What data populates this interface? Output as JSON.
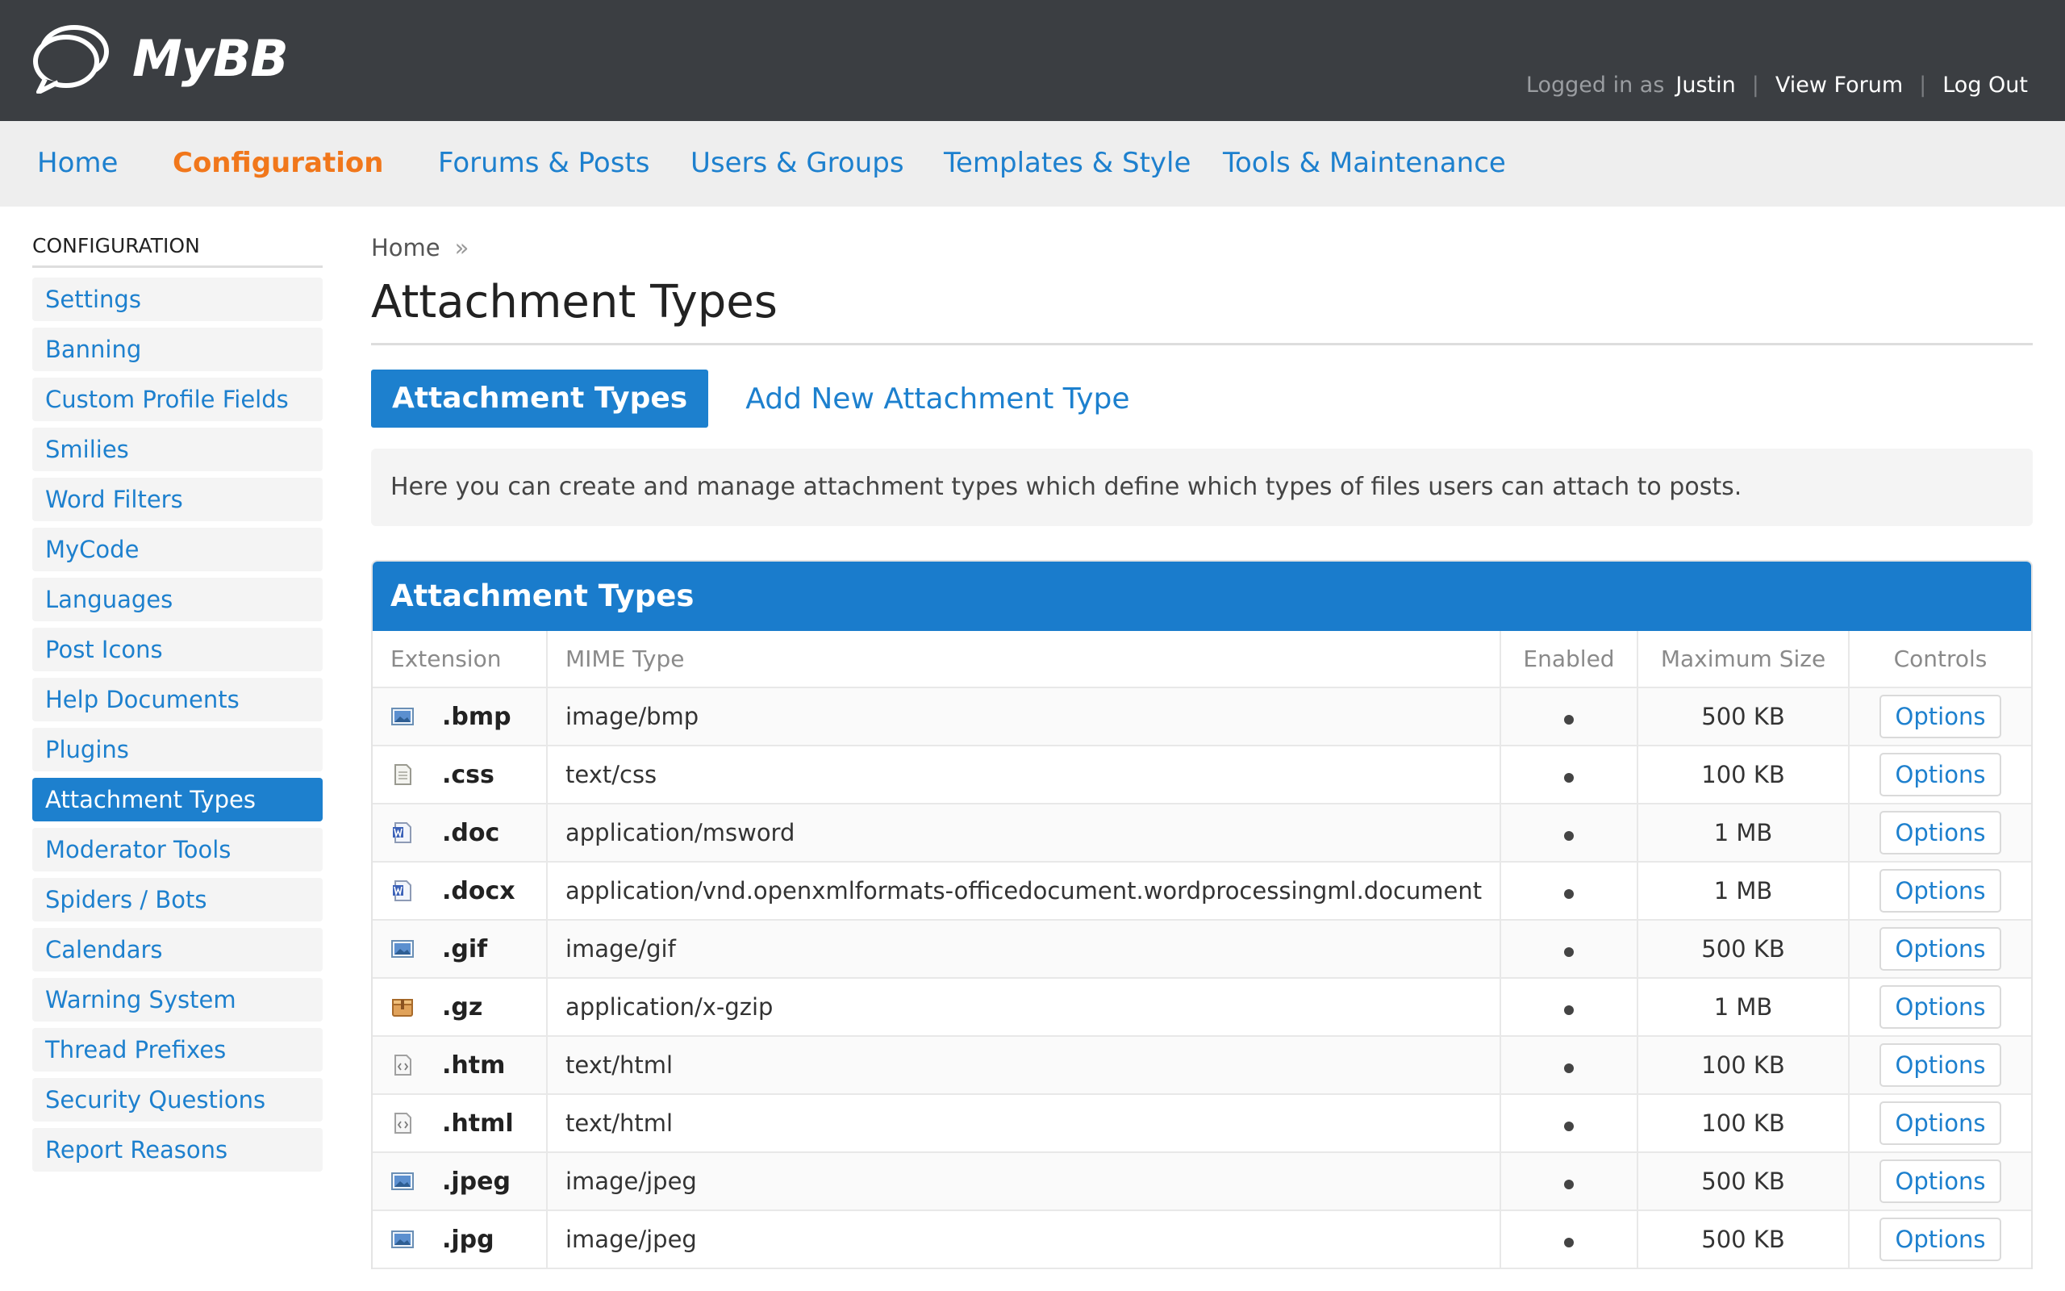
{
  "header": {
    "logo_text": "MyBB",
    "logged_in_as": "Logged in as",
    "username": "Justin",
    "view_forum": "View Forum",
    "log_out": "Log Out",
    "separator": "|"
  },
  "nav": {
    "items": [
      "Home",
      "Configuration",
      "Forums & Posts",
      "Users & Groups",
      "Templates & Style",
      "Tools & Maintenance"
    ],
    "active": "Configuration"
  },
  "sidebar": {
    "title": "CONFIGURATION",
    "items": [
      "Settings",
      "Banning",
      "Custom Profile Fields",
      "Smilies",
      "Word Filters",
      "MyCode",
      "Languages",
      "Post Icons",
      "Help Documents",
      "Plugins",
      "Attachment Types",
      "Moderator Tools",
      "Spiders / Bots",
      "Calendars",
      "Warning System",
      "Thread Prefixes",
      "Security Questions",
      "Report Reasons"
    ],
    "active": "Attachment Types"
  },
  "breadcrumb": {
    "home": "Home",
    "sep": "»"
  },
  "page_title": "Attachment Types",
  "tabs": {
    "active": "Attachment Types",
    "other": "Add New Attachment Type"
  },
  "description": "Here you can create and manage attachment types which define which types of files users can attach to posts.",
  "table": {
    "title": "Attachment Types",
    "columns": [
      "Extension",
      "MIME Type",
      "Enabled",
      "Maximum Size",
      "Controls"
    ],
    "rows": [
      {
        "icon": "image-file-icon",
        "ext": ".bmp",
        "mime": "image/bmp",
        "size": "500 KB",
        "control": "Options"
      },
      {
        "icon": "text-file-icon",
        "ext": ".css",
        "mime": "text/css",
        "size": "100 KB",
        "control": "Options"
      },
      {
        "icon": "word-file-icon",
        "ext": ".doc",
        "mime": "application/msword",
        "size": "1 MB",
        "control": "Options"
      },
      {
        "icon": "word-file-icon",
        "ext": ".docx",
        "mime": "application/vnd.openxmlformats-officedocument.wordprocessingml.document",
        "size": "1 MB",
        "control": "Options"
      },
      {
        "icon": "image-file-icon",
        "ext": ".gif",
        "mime": "image/gif",
        "size": "500 KB",
        "control": "Options"
      },
      {
        "icon": "archive-file-icon",
        "ext": ".gz",
        "mime": "application/x-gzip",
        "size": "1 MB",
        "control": "Options"
      },
      {
        "icon": "html-file-icon",
        "ext": ".htm",
        "mime": "text/html",
        "size": "100 KB",
        "control": "Options"
      },
      {
        "icon": "html-file-icon",
        "ext": ".html",
        "mime": "text/html",
        "size": "100 KB",
        "control": "Options"
      },
      {
        "icon": "image-file-icon",
        "ext": ".jpeg",
        "mime": "image/jpeg",
        "size": "500 KB",
        "control": "Options"
      },
      {
        "icon": "image-file-icon",
        "ext": ".jpg",
        "mime": "image/jpeg",
        "size": "500 KB",
        "control": "Options"
      }
    ]
  },
  "colors": {
    "header_bg": "#3b3e42",
    "accent": "#1d80ce",
    "active_nav": "#f1771b"
  }
}
